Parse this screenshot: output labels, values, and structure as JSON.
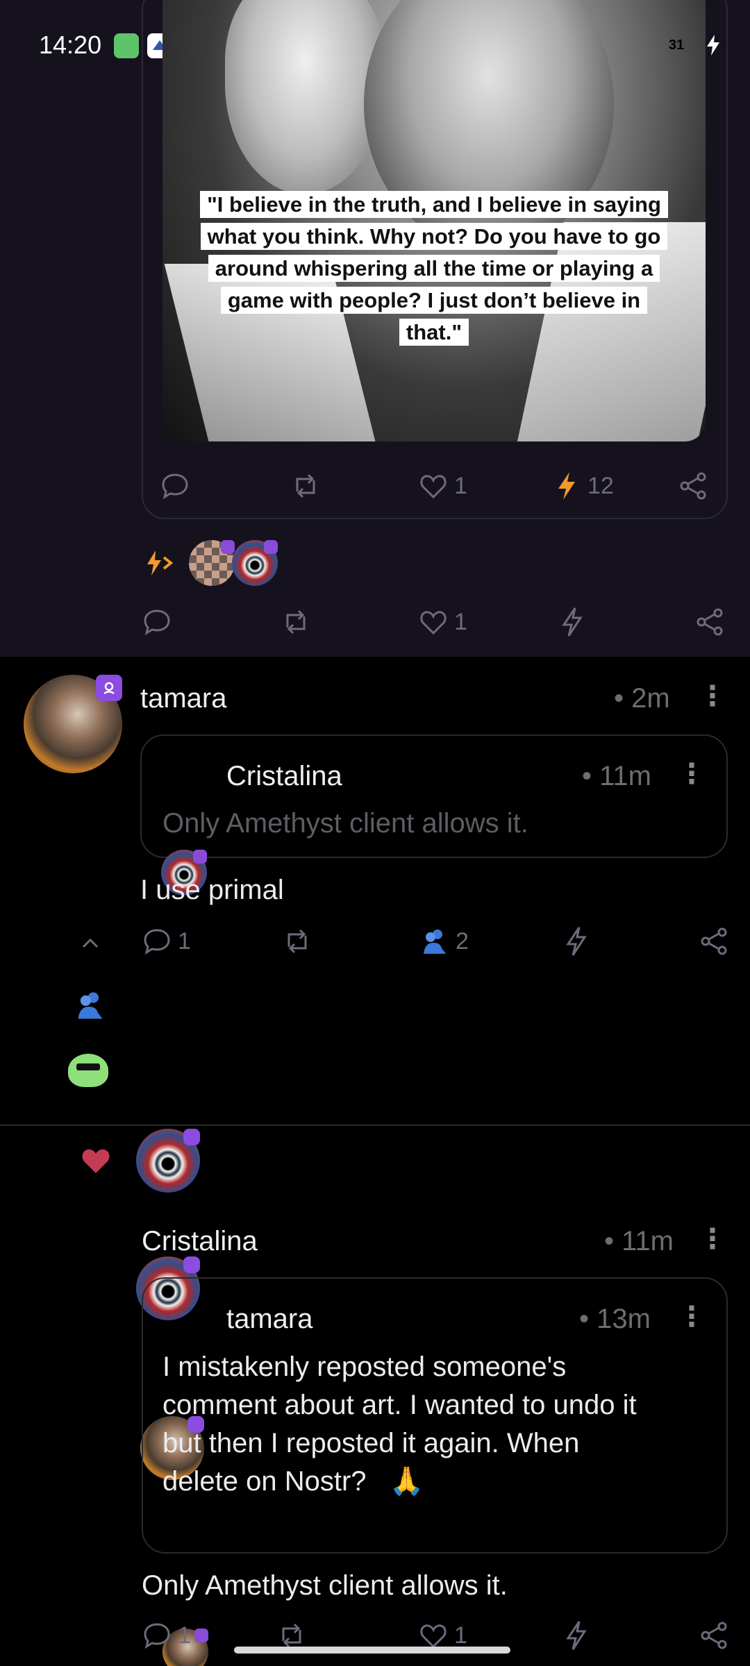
{
  "status_bar": {
    "time": "14:20",
    "battery": "31",
    "icons": [
      "sim-app-icon",
      "home-app-icon",
      "cloud-icon",
      "signal-icon",
      "wifi-icon",
      "battery-icon",
      "charging-icon"
    ]
  },
  "top_post": {
    "quote_lines": [
      "\"I believe in the truth, and I believe in saying",
      "what you think. Why not? Do you have to go",
      "around whispering all the time or playing a",
      "game with people? I just don’t believe in",
      "that.\""
    ],
    "inner_actions": {
      "likes": "1",
      "zaps": "12"
    },
    "outer_actions": {
      "likes": "1"
    }
  },
  "reply_post": {
    "author": "tamara",
    "time": "2m",
    "quoted": {
      "author": "Cristalina",
      "time": "11m",
      "text": "Only Amethyst client allows it."
    },
    "text": "I use primal",
    "actions": {
      "replies": "1",
      "reactions": "2"
    }
  },
  "third_post": {
    "author": "Cristalina",
    "time": "11m",
    "quoted": {
      "author": "tamara",
      "time": "13m",
      "text_lines": [
        "I mistakenly reposted someone's",
        "comment about art. I wanted to undo it",
        "but then I reposted it again. When",
        "delete on Nostr?"
      ],
      "emoji": "🙏"
    },
    "text": "Only Amethyst client allows it.",
    "actions": {
      "replies": "1",
      "likes": "1"
    }
  },
  "colors": {
    "zap": "#f0992e",
    "like_heart": "#c43c53",
    "badge": "#8b4ce0",
    "reaction_green": "#8ee07a"
  }
}
